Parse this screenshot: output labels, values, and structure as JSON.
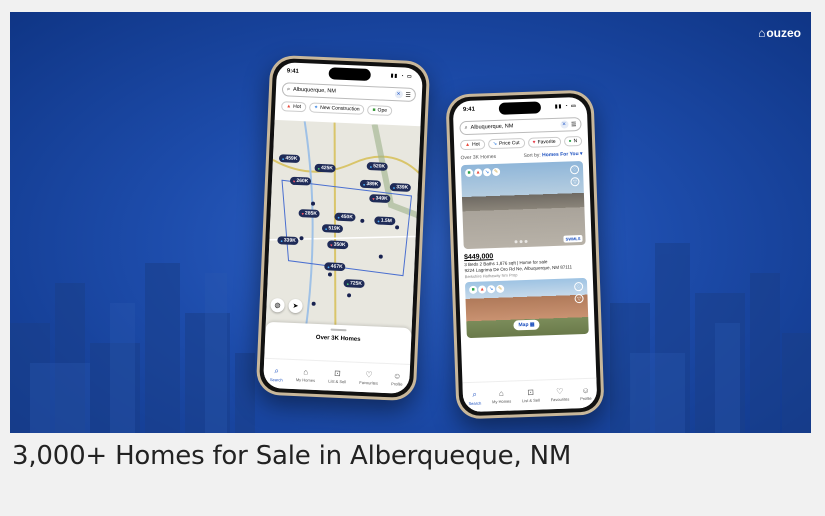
{
  "brand": {
    "name": "ouzeo",
    "icon": "house-logo-icon"
  },
  "caption": "3,000+ Homes for Sale in Alberqueque, NM",
  "phone_map": {
    "time": "9:41",
    "search": "Albuquerque, NM",
    "chips": [
      {
        "label": "Hot",
        "icon": "fire-icon"
      },
      {
        "label": "New Construction",
        "icon": "new-construction-icon"
      },
      {
        "label": "Ope",
        "icon": "open-house-icon"
      }
    ],
    "pins": [
      {
        "label": "459K",
        "style": "blue"
      },
      {
        "label": "425K",
        "style": "green"
      },
      {
        "label": "520K",
        "style": "blue"
      },
      {
        "label": "260K",
        "style": "red"
      },
      {
        "label": "389K",
        "style": "blue"
      },
      {
        "label": "339K",
        "style": "blue"
      },
      {
        "label": "349K",
        "style": "red"
      },
      {
        "label": "285K",
        "style": "red"
      },
      {
        "label": "450K",
        "style": "blue"
      },
      {
        "label": "1.5M",
        "style": "blue"
      },
      {
        "label": "519K",
        "style": "blue"
      },
      {
        "label": "339K",
        "style": "blue"
      },
      {
        "label": "350K",
        "style": "red"
      },
      {
        "label": "467K",
        "style": "blue"
      },
      {
        "label": "725K",
        "style": "green"
      }
    ],
    "sheet_title": "Over 3K Homes",
    "tabs": [
      {
        "label": "Search",
        "icon": "search-icon"
      },
      {
        "label": "My Homes",
        "icon": "home-icon"
      },
      {
        "label": "List & Sell",
        "icon": "list-sell-icon"
      },
      {
        "label": "Favourites",
        "icon": "heart-icon"
      },
      {
        "label": "Profile",
        "icon": "profile-icon"
      }
    ]
  },
  "phone_list": {
    "time": "9:41",
    "search": "Albuquerque, NM",
    "chips": [
      {
        "label": "Hot",
        "icon": "fire-icon"
      },
      {
        "label": "Price Cut",
        "icon": "price-cut-icon"
      },
      {
        "label": "Favorite",
        "icon": "heart-icon"
      },
      {
        "label": "N",
        "icon": "new-icon"
      }
    ],
    "count": "Over 3K Homes",
    "sort_label": "Sort by:",
    "sort_value": "Homes For You",
    "listing": {
      "price": "$449,000",
      "details": "3 Beds  2 Baths  1,876 sqft | Home for sale",
      "address": "9224 Lagrima De Oro Rd Ne, Albuquerque, NM 87111",
      "agent": "Berkshire Hathaway Nm Prop",
      "brokerage_tag": "SWMLS"
    },
    "map_button": "Map",
    "tabs": [
      {
        "label": "Search",
        "icon": "search-icon"
      },
      {
        "label": "My Homes",
        "icon": "home-icon"
      },
      {
        "label": "List & Sell",
        "icon": "list-sell-icon"
      },
      {
        "label": "Favourites",
        "icon": "heart-icon"
      },
      {
        "label": "Profile",
        "icon": "profile-icon"
      }
    ]
  }
}
